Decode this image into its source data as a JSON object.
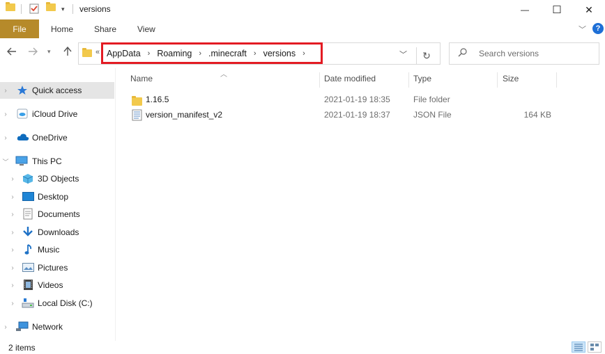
{
  "window": {
    "title": "versions",
    "minimize_glyph": "—",
    "maximize_glyph": "☐",
    "close_glyph": "✕"
  },
  "ribbon": {
    "tabs": [
      {
        "label": "File"
      },
      {
        "label": "Home"
      },
      {
        "label": "Share"
      },
      {
        "label": "View"
      }
    ],
    "help_glyph": "?"
  },
  "address_bar": {
    "overflow_glyph": "«",
    "crumbs": [
      "AppData",
      "Roaming",
      ".minecraft",
      "versions"
    ],
    "highlight_color": "#e31b23"
  },
  "search": {
    "placeholder": "Search versions"
  },
  "sidebar": {
    "items": [
      {
        "label": "Quick access",
        "icon": "star-icon"
      },
      {
        "label": "iCloud Drive",
        "icon": "icloud-icon"
      },
      {
        "label": "OneDrive",
        "icon": "cloud-icon"
      },
      {
        "label": "This PC",
        "icon": "computer-icon"
      },
      {
        "label": "3D Objects",
        "icon": "cube-icon"
      },
      {
        "label": "Desktop",
        "icon": "desktop-icon"
      },
      {
        "label": "Documents",
        "icon": "document-icon"
      },
      {
        "label": "Downloads",
        "icon": "download-arrow-icon"
      },
      {
        "label": "Music",
        "icon": "music-note-icon"
      },
      {
        "label": "Pictures",
        "icon": "picture-icon"
      },
      {
        "label": "Videos",
        "icon": "film-icon"
      },
      {
        "label": "Local Disk (C:)",
        "icon": "drive-icon"
      },
      {
        "label": "Network",
        "icon": "network-icon"
      }
    ]
  },
  "columns": {
    "name": "Name",
    "date_modified": "Date modified",
    "type": "Type",
    "size": "Size"
  },
  "files": [
    {
      "name": "1.16.5",
      "date_modified": "2021-01-19 18:35",
      "type": "File folder",
      "size": "",
      "icon": "folder-icon"
    },
    {
      "name": "version_manifest_v2",
      "date_modified": "2021-01-19 18:37",
      "type": "JSON File",
      "size": "164 KB",
      "icon": "text-file-icon"
    }
  ],
  "status": {
    "item_count": "2 items"
  },
  "colors": {
    "file_tab": "#b68a2a",
    "selected_nav": "#e5e5e5",
    "help": "#1e6fd6"
  }
}
